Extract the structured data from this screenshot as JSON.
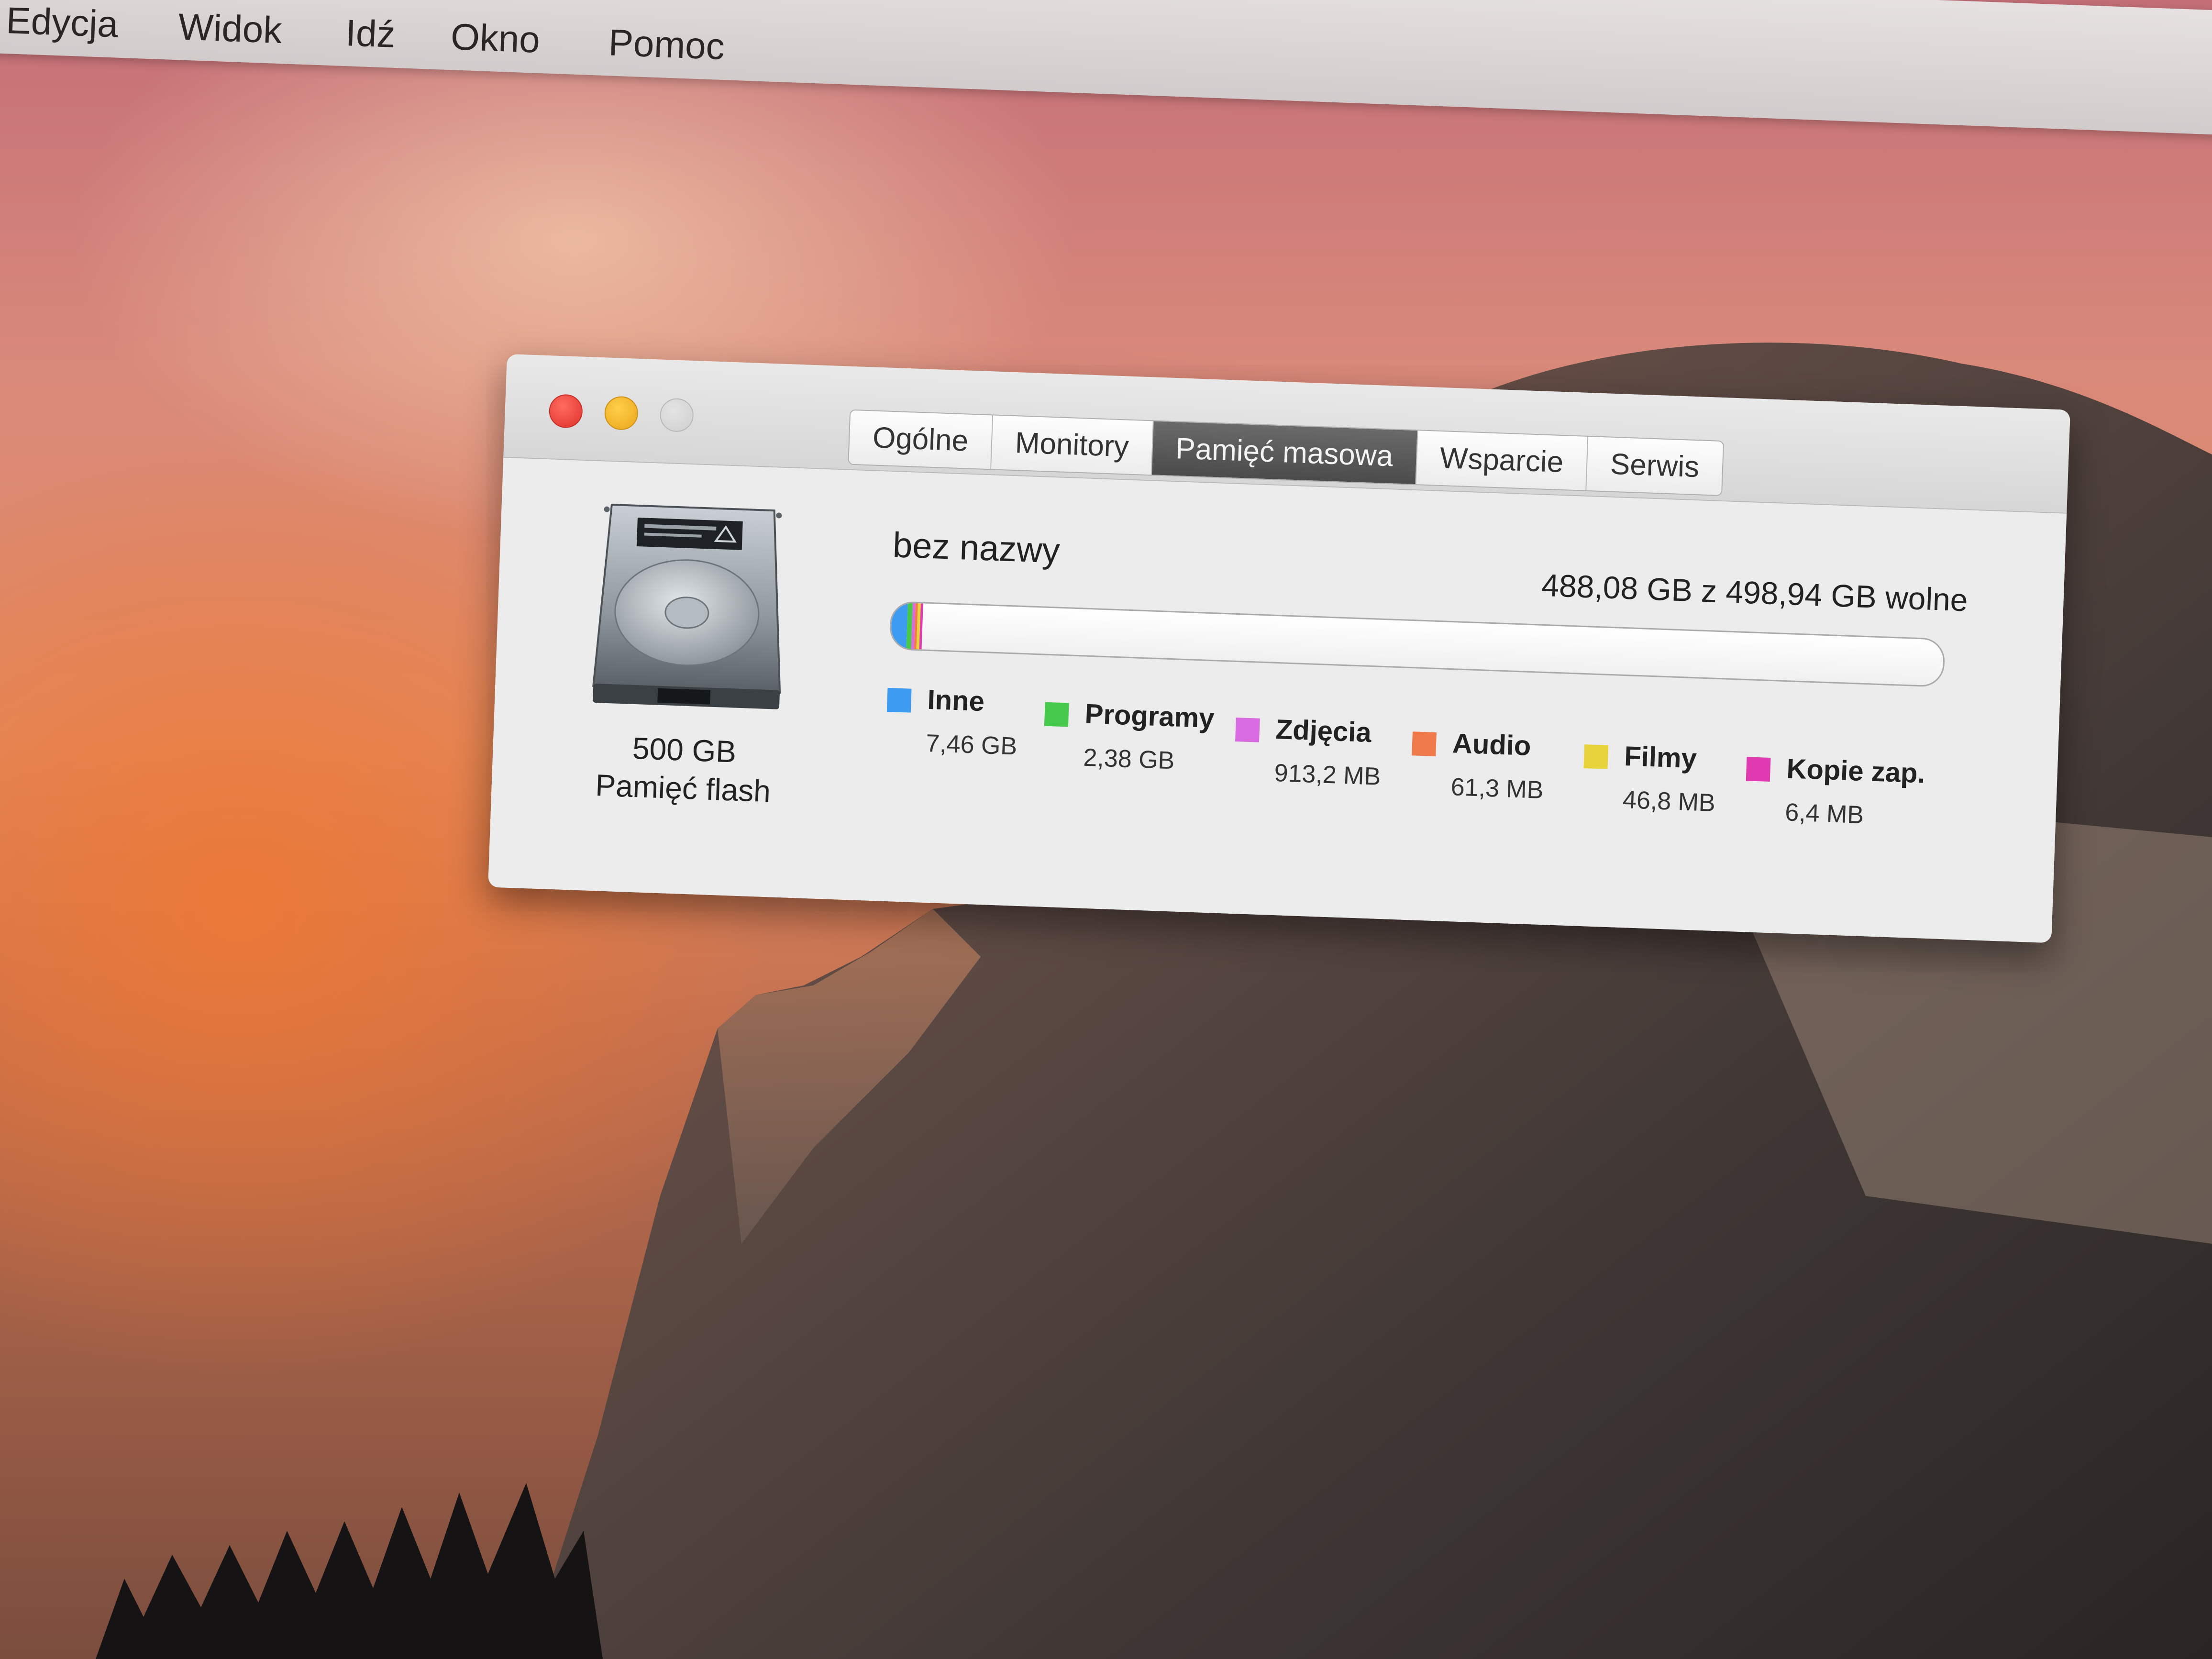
{
  "menu": {
    "items": [
      "Edycja",
      "Widok",
      "Idź",
      "Okno",
      "Pomoc"
    ]
  },
  "window": {
    "tabs": [
      {
        "label": "Ogólne",
        "selected": false
      },
      {
        "label": "Monitory",
        "selected": false
      },
      {
        "label": "Pamięć masowa",
        "selected": true
      },
      {
        "label": "Wsparcie",
        "selected": false
      },
      {
        "label": "Serwis",
        "selected": false
      }
    ],
    "drive": {
      "capacity": "500 GB",
      "type": "Pamięć flash",
      "icon": "hard-drive-icon"
    },
    "volume": {
      "name": "bez nazwy",
      "free_text": "488,08 GB z 498,94 GB wolne",
      "used_fraction": 0.0218
    },
    "legend": [
      {
        "label": "Inne",
        "value": "7,46 GB",
        "color": "#3d9bf0"
      },
      {
        "label": "Programy",
        "value": "2,38 GB",
        "color": "#46c94a"
      },
      {
        "label": "Zdjęcia",
        "value": "913,2 MB",
        "color": "#d96be0"
      },
      {
        "label": "Audio",
        "value": "61,3 MB",
        "color": "#f07a4a"
      },
      {
        "label": "Filmy",
        "value": "46,8 MB",
        "color": "#e8d43a"
      },
      {
        "label": "Kopie zap.",
        "value": "6,4 MB",
        "color": "#e03ab0"
      }
    ]
  }
}
